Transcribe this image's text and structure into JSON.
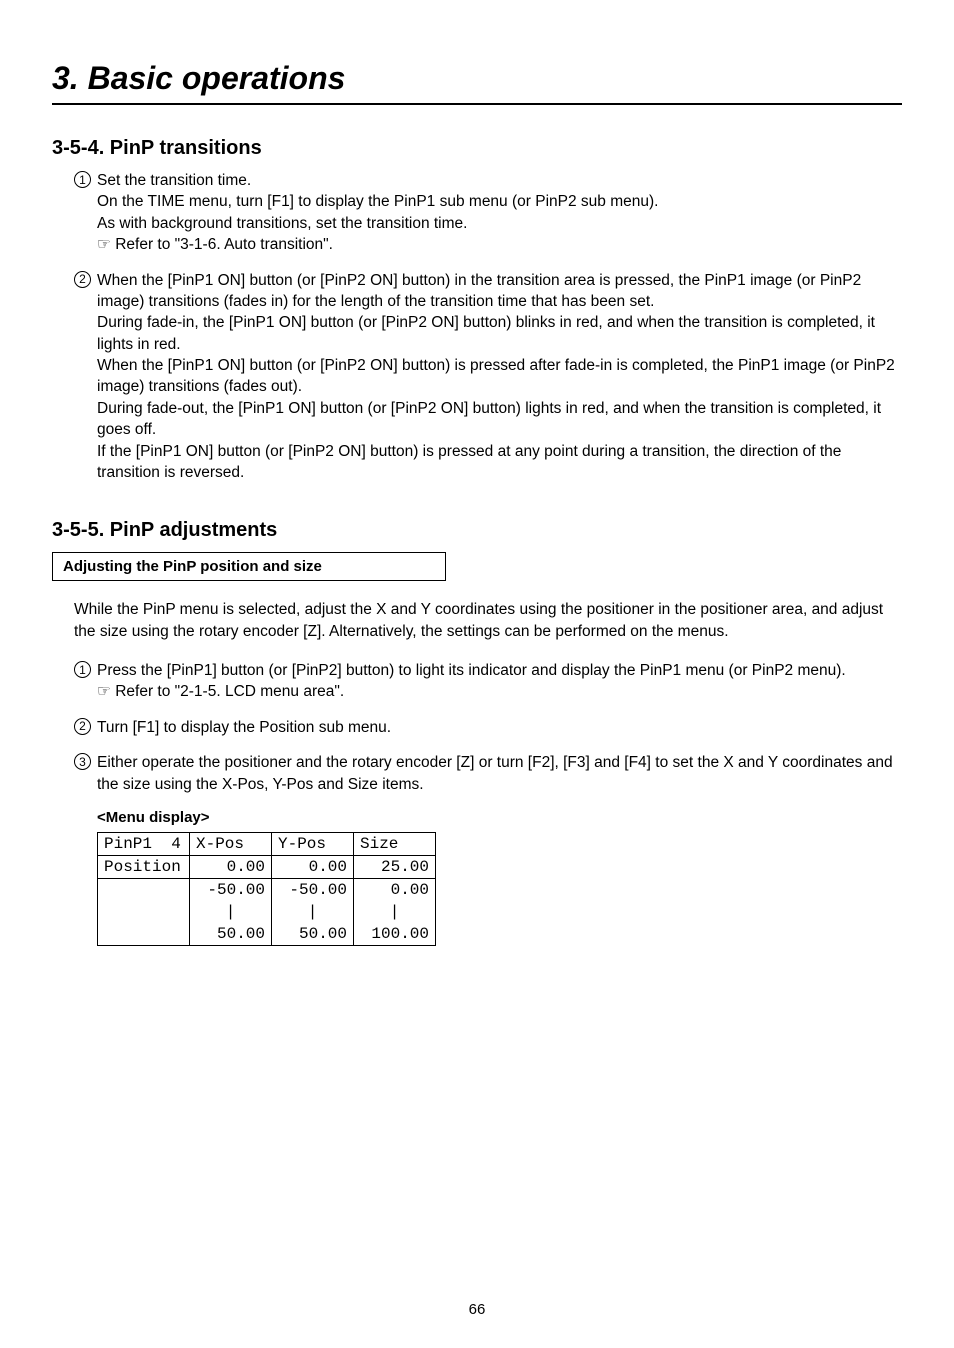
{
  "chapter": "3. Basic operations",
  "section354": {
    "heading": "3-5-4. PinP transitions",
    "step1": {
      "line1": "Set the transition time.",
      "line2": "On the TIME menu, turn [F1] to display the PinP1 sub menu (or PinP2 sub menu).",
      "line3": "As with background transitions, set the transition time.",
      "refer": "☞ Refer to \"3-1-6. Auto transition\"."
    },
    "step2": {
      "line1": "When the [PinP1 ON] button (or [PinP2 ON] button) in the transition area is pressed, the PinP1 image (or PinP2 image) transitions (fades in) for the length of the transition time that has been set.",
      "line2": "During fade-in, the [PinP1 ON] button (or [PinP2 ON] button) blinks in red, and when the transition is completed, it lights in red.",
      "line3": "When the [PinP1 ON] button (or [PinP2 ON] button) is pressed after fade-in is completed, the PinP1 image (or PinP2 image) transitions (fades out).",
      "line4": "During fade-out, the [PinP1 ON] button (or [PinP2 ON] button) lights in red, and when the transition is completed, it goes off.",
      "line5": "If the [PinP1 ON] button (or [PinP2 ON] button) is pressed at any point during a transition, the direction of the transition is reversed."
    }
  },
  "section355": {
    "heading": "3-5-5. PinP adjustments",
    "boxTitle": "Adjusting the PinP position and size",
    "intro": "While the PinP menu is selected, adjust the X and Y coordinates using the positioner in the positioner area, and adjust the size using the rotary encoder [Z]. Alternatively, the settings can be performed on the menus.",
    "step1": {
      "line1": "Press the [PinP1] button (or [PinP2] button) to light its indicator and display the PinP1 menu (or PinP2 menu).",
      "refer": "☞ Refer to \"2-1-5. LCD menu area\"."
    },
    "step2": "Turn [F1] to display the Position sub menu.",
    "step3": "Either operate the positioner and the rotary encoder [Z] or turn [F2], [F3] and [F4] to set the X and Y coordinates and the size using the X-Pos, Y-Pos and Size items.",
    "menuLabel": "<Menu display>",
    "menuTable": {
      "r1c1": "PinP1  4",
      "r1c2": "X-Pos",
      "r1c3": "Y-Pos",
      "r1c4": "Size",
      "r2c1": "Position",
      "r2c2": "0.00",
      "r2c3": "0.00",
      "r2c4": "25.00",
      "r3c2": "-50.00",
      "r3c3": "-50.00",
      "r3c4": "0.00",
      "r4c2": "|",
      "r4c3": "|",
      "r4c4": "|",
      "r5c2": "50.00",
      "r5c3": "50.00",
      "r5c4": "100.00"
    }
  },
  "pageNumber": "66"
}
